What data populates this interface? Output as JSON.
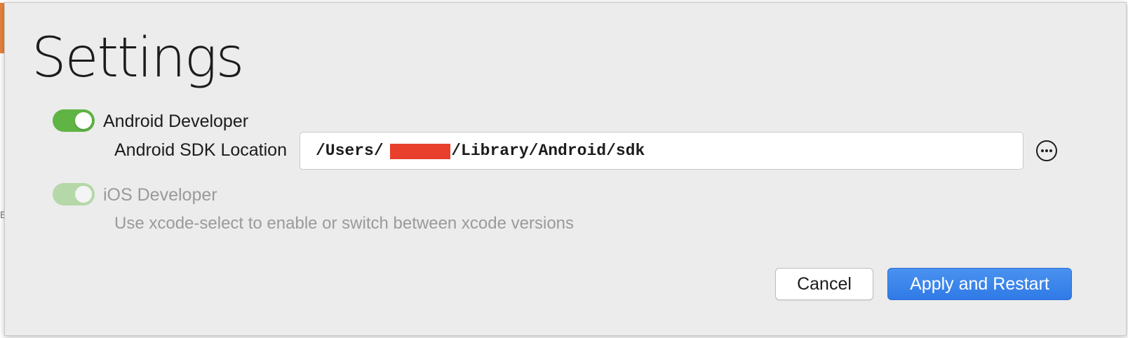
{
  "dialog": {
    "title": "Settings",
    "android": {
      "toggle_state": "on",
      "label": "Android Developer",
      "sdk_location_label": "Android SDK Location",
      "sdk_path": "/Users/      s/Library/Android/sdk",
      "browse_icon": "ellipsis-circle-icon"
    },
    "ios": {
      "toggle_state": "on-disabled",
      "label": "iOS Developer",
      "hint": "Use xcode-select to enable or switch between xcode versions"
    },
    "buttons": {
      "cancel_label": "Cancel",
      "apply_label": "Apply and Restart"
    }
  },
  "colors": {
    "toggle_on": "#5fb444",
    "toggle_disabled": "#b5d8a8",
    "primary_button": "#3a84ec",
    "redaction": "#e8402c"
  }
}
